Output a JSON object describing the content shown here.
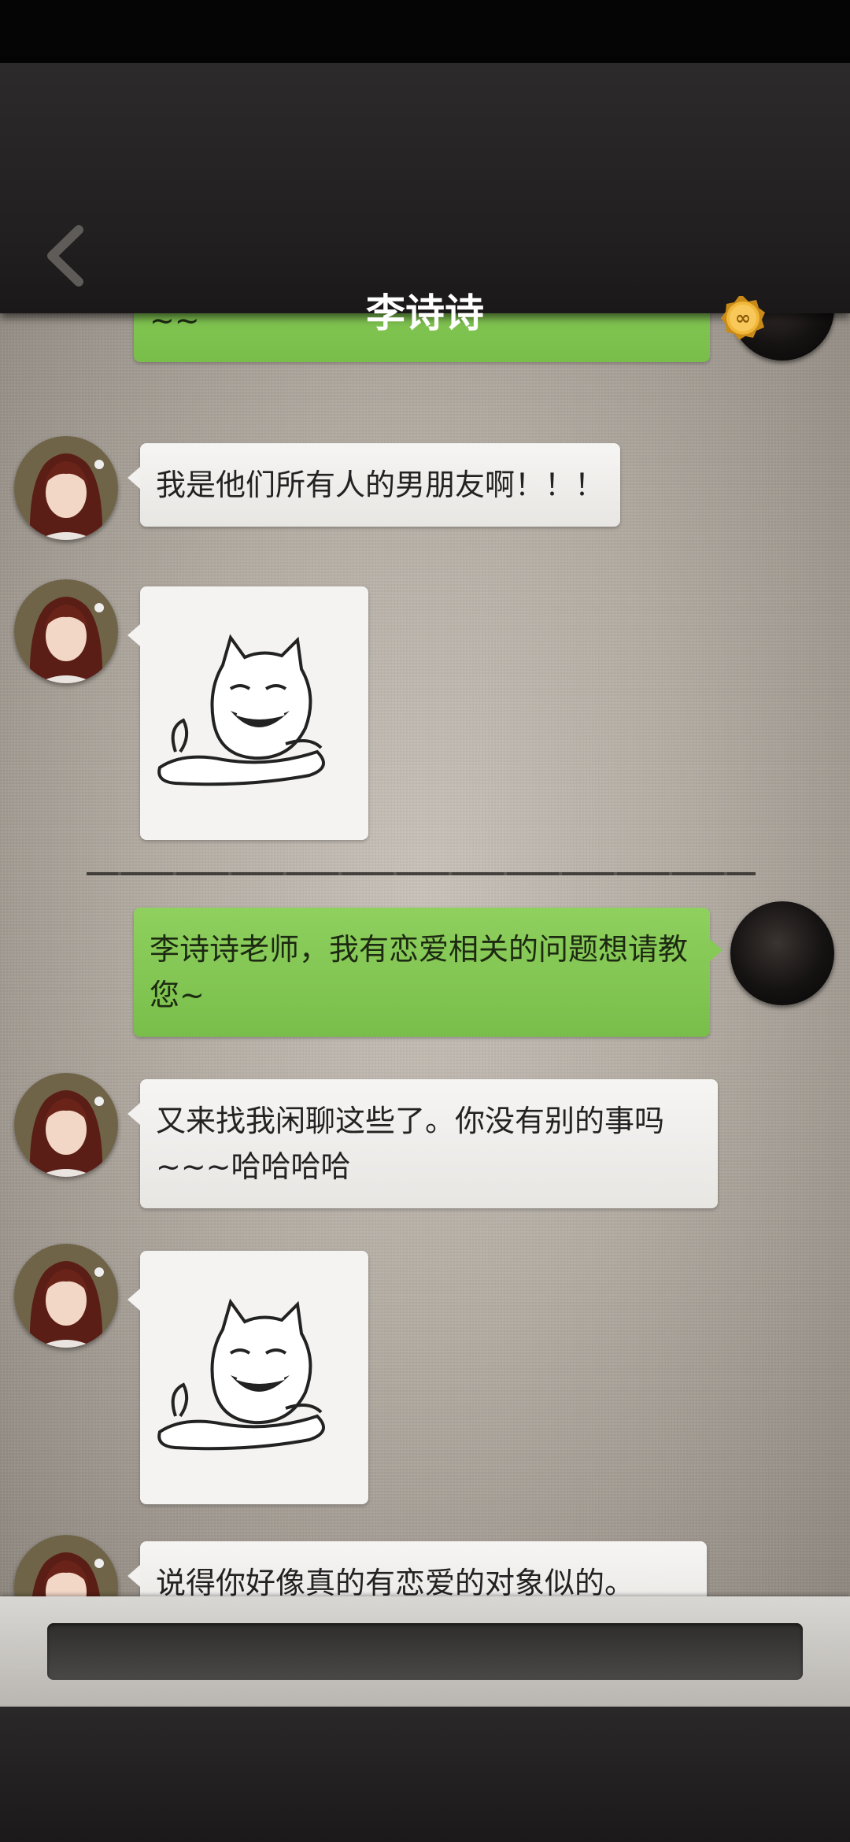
{
  "header": {
    "title": "李诗诗",
    "back_icon": "chevron-left-icon",
    "coin_icon": "gold-coin-icon",
    "coin_symbol": "∞"
  },
  "messages": {
    "m1": {
      "sender": "self",
      "text": "那你自己呢！这位“觉得自己很般”的朋友~~"
    },
    "m2": {
      "sender": "contact",
      "text": "我是他们所有人的男朋友啊！！！"
    },
    "m3": {
      "sender": "contact",
      "sticker": "laughing-cat-meme"
    },
    "m4": {
      "sender": "self",
      "text": "李诗诗老师，我有恋爱相关的问题想请教您~"
    },
    "m5": {
      "sender": "contact",
      "text": "又来找我闲聊这些了。你没有别的事吗~~~哈哈哈哈"
    },
    "m6": {
      "sender": "contact",
      "sticker": "laughing-cat-meme"
    },
    "m7": {
      "sender": "contact",
      "text": "说得你好像真的有恋爱的对象似的。"
    }
  },
  "input": {
    "placeholder": ""
  },
  "colors": {
    "self_bubble": "#86c957",
    "contact_bubble": "#f2f1ef",
    "nav_bg": "#262424"
  }
}
